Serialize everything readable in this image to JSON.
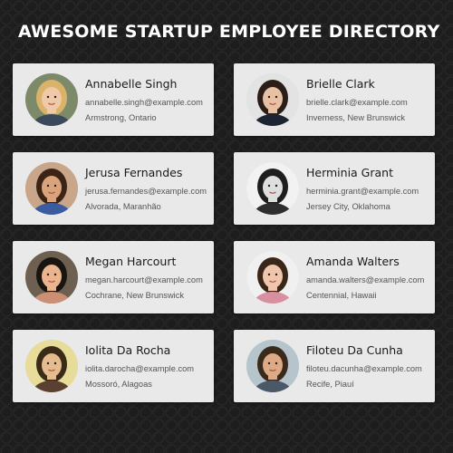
{
  "page": {
    "title": "AWESOME STARTUP EMPLOYEE DIRECTORY",
    "background_color": "#1d1d1d",
    "card_color": "#e9e9e9"
  },
  "employees": [
    {
      "name": "Annabelle Singh",
      "email": "annabelle.singh@example.com",
      "location": "Armstrong, Ontario",
      "hair": "#d9b36a",
      "skin": "#f0caa8",
      "shirt": "#3a4a5a",
      "bg": "#7c8a6a"
    },
    {
      "name": "Brielle Clark",
      "email": "brielle.clark@example.com",
      "location": "Inverness, New Brunswick",
      "hair": "#2b1d17",
      "skin": "#e8c1a5",
      "shirt": "#1c2433",
      "bg": "#e3e3e3"
    },
    {
      "name": "Jerusa Fernandes",
      "email": "jerusa.fernandes@example.com",
      "location": "Alvorada, Maranhão",
      "hair": "#3b2416",
      "skin": "#d9a47c",
      "shirt": "#3b5ba0",
      "bg": "#c9a58a"
    },
    {
      "name": "Herminia Grant",
      "email": "herminia.grant@example.com",
      "location": "Jersey City, Oklahoma",
      "hair": "#1e1e1e",
      "skin": "#dedede",
      "shirt": "#2e2e2e",
      "bg": "#f2f2f2"
    },
    {
      "name": "Megan Harcourt",
      "email": "megan.harcourt@example.com",
      "location": "Cochrane, New Brunswick",
      "hair": "#1a1410",
      "skin": "#e9b48e",
      "shirt": "#cc8f74",
      "bg": "#6d6050"
    },
    {
      "name": "Amanda Walters",
      "email": "amanda.walters@example.com",
      "location": "Centennial, Hawaii",
      "hair": "#3a2618",
      "skin": "#efc6ab",
      "shirt": "#d88fa0",
      "bg": "#f0f0f0"
    },
    {
      "name": "Iolita Da Rocha",
      "email": "iolita.darocha@example.com",
      "location": "Mossoró, Alagoas",
      "hair": "#3a2a18",
      "skin": "#e5bb90",
      "shirt": "#5a4030",
      "bg": "#e8dc9a"
    },
    {
      "name": "Filoteu Da Cunha",
      "email": "filoteu.dacunha@example.com",
      "location": "Recife, Piauí",
      "hair": "#3a2a1c",
      "skin": "#dcab86",
      "shirt": "#4a5868",
      "bg": "#b6c4cc"
    }
  ]
}
